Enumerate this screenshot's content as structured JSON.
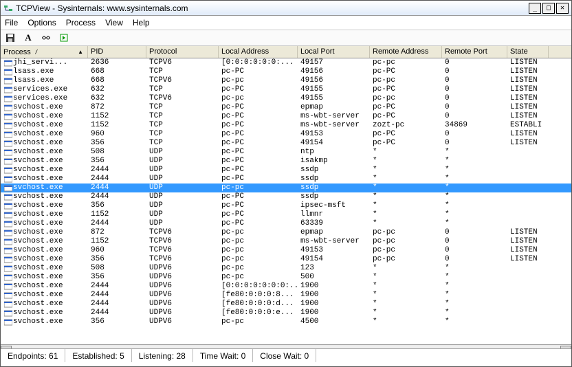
{
  "window": {
    "title": "TCPView - Sysinternals: www.sysinternals.com"
  },
  "menu": {
    "file": "File",
    "options": "Options",
    "process": "Process",
    "view": "View",
    "help": "Help"
  },
  "columns": [
    "Process",
    "PID",
    "Protocol",
    "Local Address",
    "Local Port",
    "Remote Address",
    "Remote Port",
    "State"
  ],
  "rows": [
    {
      "proc": "jhi_servi...",
      "pid": "2636",
      "proto": "TCPV6",
      "laddr": "[0:0:0:0:0:0:...",
      "lport": "49157",
      "raddr": "pc-pc",
      "rport": "0",
      "state": "LISTEN",
      "sel": false
    },
    {
      "proc": "lsass.exe",
      "pid": "668",
      "proto": "TCP",
      "laddr": "pc-PC",
      "lport": "49156",
      "raddr": "pc-PC",
      "rport": "0",
      "state": "LISTEN",
      "sel": false
    },
    {
      "proc": "lsass.exe",
      "pid": "668",
      "proto": "TCPV6",
      "laddr": "pc-pc",
      "lport": "49156",
      "raddr": "pc-pc",
      "rport": "0",
      "state": "LISTEN",
      "sel": false
    },
    {
      "proc": "services.exe",
      "pid": "632",
      "proto": "TCP",
      "laddr": "pc-PC",
      "lport": "49155",
      "raddr": "pc-PC",
      "rport": "0",
      "state": "LISTEN",
      "sel": false
    },
    {
      "proc": "services.exe",
      "pid": "632",
      "proto": "TCPV6",
      "laddr": "pc-pc",
      "lport": "49155",
      "raddr": "pc-pc",
      "rport": "0",
      "state": "LISTEN",
      "sel": false
    },
    {
      "proc": "svchost.exe",
      "pid": "872",
      "proto": "TCP",
      "laddr": "pc-PC",
      "lport": "epmap",
      "raddr": "pc-PC",
      "rport": "0",
      "state": "LISTEN",
      "sel": false
    },
    {
      "proc": "svchost.exe",
      "pid": "1152",
      "proto": "TCP",
      "laddr": "pc-PC",
      "lport": "ms-wbt-server",
      "raddr": "pc-PC",
      "rport": "0",
      "state": "LISTEN",
      "sel": false
    },
    {
      "proc": "svchost.exe",
      "pid": "1152",
      "proto": "TCP",
      "laddr": "pc-PC",
      "lport": "ms-wbt-server",
      "raddr": "zozt-pc",
      "rport": "34869",
      "state": "ESTABLI",
      "sel": false
    },
    {
      "proc": "svchost.exe",
      "pid": "960",
      "proto": "TCP",
      "laddr": "pc-PC",
      "lport": "49153",
      "raddr": "pc-PC",
      "rport": "0",
      "state": "LISTEN",
      "sel": false
    },
    {
      "proc": "svchost.exe",
      "pid": "356",
      "proto": "TCP",
      "laddr": "pc-PC",
      "lport": "49154",
      "raddr": "pc-PC",
      "rport": "0",
      "state": "LISTEN",
      "sel": false
    },
    {
      "proc": "svchost.exe",
      "pid": "508",
      "proto": "UDP",
      "laddr": "pc-PC",
      "lport": "ntp",
      "raddr": "*",
      "rport": "*",
      "state": "",
      "sel": false
    },
    {
      "proc": "svchost.exe",
      "pid": "356",
      "proto": "UDP",
      "laddr": "pc-PC",
      "lport": "isakmp",
      "raddr": "*",
      "rport": "*",
      "state": "",
      "sel": false
    },
    {
      "proc": "svchost.exe",
      "pid": "2444",
      "proto": "UDP",
      "laddr": "pc-PC",
      "lport": "ssdp",
      "raddr": "*",
      "rport": "*",
      "state": "",
      "sel": false
    },
    {
      "proc": "svchost.exe",
      "pid": "2444",
      "proto": "UDP",
      "laddr": "pc-PC",
      "lport": "ssdp",
      "raddr": "*",
      "rport": "*",
      "state": "",
      "sel": false
    },
    {
      "proc": "svchost.exe",
      "pid": "2444",
      "proto": "UDP",
      "laddr": "pc-pc",
      "lport": "ssdp",
      "raddr": "*",
      "rport": "*",
      "state": "",
      "sel": true
    },
    {
      "proc": "svchost.exe",
      "pid": "2444",
      "proto": "UDP",
      "laddr": "pc-PC",
      "lport": "ssdp",
      "raddr": "*",
      "rport": "*",
      "state": "",
      "sel": false
    },
    {
      "proc": "svchost.exe",
      "pid": "356",
      "proto": "UDP",
      "laddr": "pc-PC",
      "lport": "ipsec-msft",
      "raddr": "*",
      "rport": "*",
      "state": "",
      "sel": false
    },
    {
      "proc": "svchost.exe",
      "pid": "1152",
      "proto": "UDP",
      "laddr": "pc-PC",
      "lport": "llmnr",
      "raddr": "*",
      "rport": "*",
      "state": "",
      "sel": false
    },
    {
      "proc": "svchost.exe",
      "pid": "2444",
      "proto": "UDP",
      "laddr": "pc-PC",
      "lport": "63339",
      "raddr": "*",
      "rport": "*",
      "state": "",
      "sel": false
    },
    {
      "proc": "svchost.exe",
      "pid": "872",
      "proto": "TCPV6",
      "laddr": "pc-pc",
      "lport": "epmap",
      "raddr": "pc-pc",
      "rport": "0",
      "state": "LISTEN",
      "sel": false
    },
    {
      "proc": "svchost.exe",
      "pid": "1152",
      "proto": "TCPV6",
      "laddr": "pc-pc",
      "lport": "ms-wbt-server",
      "raddr": "pc-pc",
      "rport": "0",
      "state": "LISTEN",
      "sel": false
    },
    {
      "proc": "svchost.exe",
      "pid": "960",
      "proto": "TCPV6",
      "laddr": "pc-pc",
      "lport": "49153",
      "raddr": "pc-pc",
      "rport": "0",
      "state": "LISTEN",
      "sel": false
    },
    {
      "proc": "svchost.exe",
      "pid": "356",
      "proto": "TCPV6",
      "laddr": "pc-pc",
      "lport": "49154",
      "raddr": "pc-pc",
      "rport": "0",
      "state": "LISTEN",
      "sel": false
    },
    {
      "proc": "svchost.exe",
      "pid": "508",
      "proto": "UDPV6",
      "laddr": "pc-pc",
      "lport": "123",
      "raddr": "*",
      "rport": "*",
      "state": "",
      "sel": false
    },
    {
      "proc": "svchost.exe",
      "pid": "356",
      "proto": "UDPV6",
      "laddr": "pc-pc",
      "lport": "500",
      "raddr": "*",
      "rport": "*",
      "state": "",
      "sel": false
    },
    {
      "proc": "svchost.exe",
      "pid": "2444",
      "proto": "UDPV6",
      "laddr": "[0:0:0:0:0:0:0:...",
      "lport": "1900",
      "raddr": "*",
      "rport": "*",
      "state": "",
      "sel": false
    },
    {
      "proc": "svchost.exe",
      "pid": "2444",
      "proto": "UDPV6",
      "laddr": "[fe80:0:0:0:8...",
      "lport": "1900",
      "raddr": "*",
      "rport": "*",
      "state": "",
      "sel": false
    },
    {
      "proc": "svchost.exe",
      "pid": "2444",
      "proto": "UDPV6",
      "laddr": "[fe80:0:0:0:d...",
      "lport": "1900",
      "raddr": "*",
      "rport": "*",
      "state": "",
      "sel": false
    },
    {
      "proc": "svchost.exe",
      "pid": "2444",
      "proto": "UDPV6",
      "laddr": "[fe80:0:0:0:e...",
      "lport": "1900",
      "raddr": "*",
      "rport": "*",
      "state": "",
      "sel": false
    },
    {
      "proc": "svchost.exe",
      "pid": "356",
      "proto": "UDPV6",
      "laddr": "pc-pc",
      "lport": "4500",
      "raddr": "*",
      "rport": "*",
      "state": "",
      "sel": false
    }
  ],
  "status": {
    "endpoints": "Endpoints: 61",
    "established": "Established: 5",
    "listening": "Listening: 28",
    "timewait": "Time Wait: 0",
    "closewait": "Close Wait: 0"
  }
}
